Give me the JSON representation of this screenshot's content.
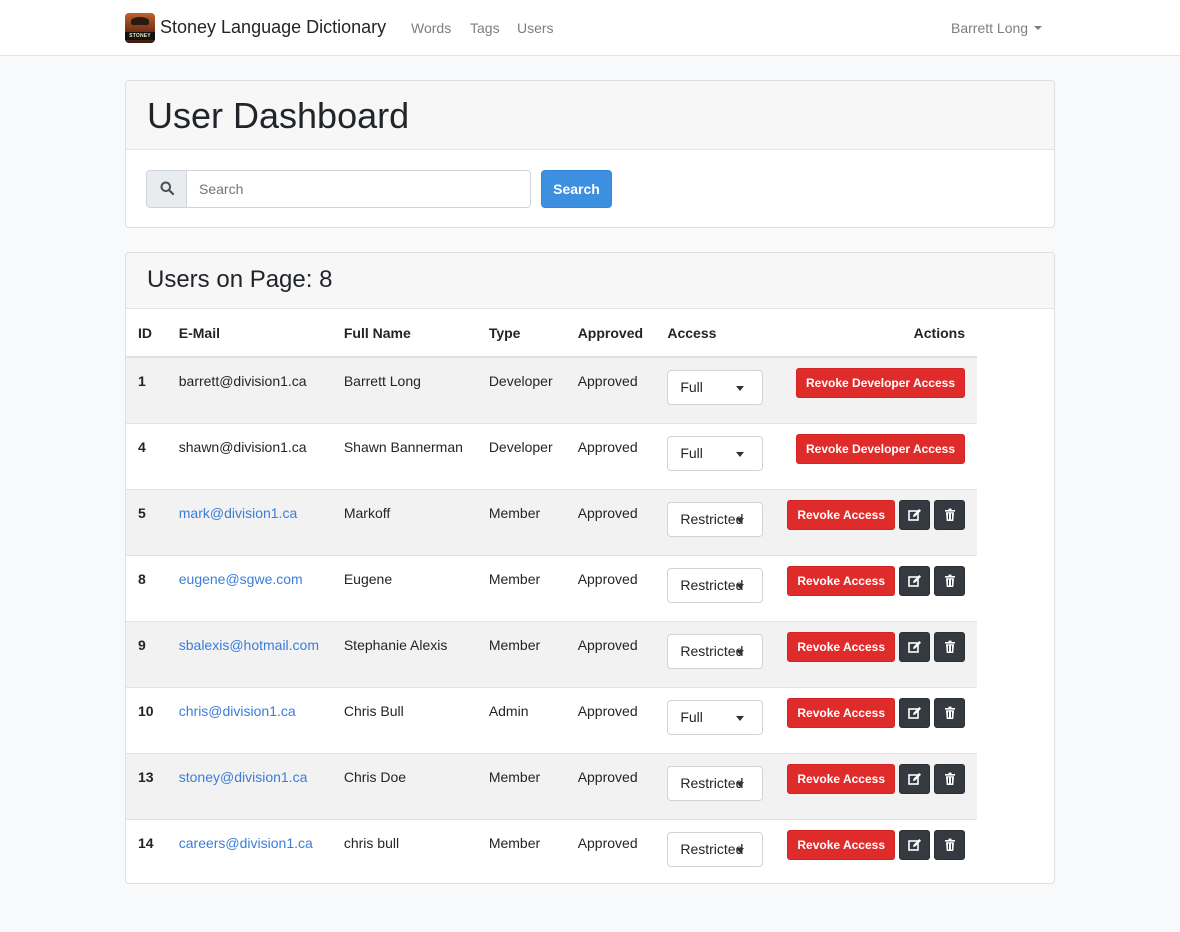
{
  "navbar": {
    "logo_text": "STONEY",
    "brand": "Stoney Language Dictionary",
    "links": [
      "Words",
      "Tags",
      "Users"
    ],
    "user": "Barrett Long"
  },
  "dashboard": {
    "title": "User Dashboard",
    "search_placeholder": "Search",
    "search_button": "Search"
  },
  "users_section": {
    "title": "Users on Page: 8"
  },
  "table": {
    "headers": [
      "ID",
      "E-Mail",
      "Full Name",
      "Type",
      "Approved",
      "Access",
      "Actions"
    ],
    "rows": [
      {
        "id": "1",
        "email": "barrett@division1.ca",
        "name": "Barrett Long",
        "type": "Developer",
        "approved": "Approved",
        "access": "Full",
        "action": "Revoke Developer Access",
        "linked": false,
        "icons": false
      },
      {
        "id": "4",
        "email": "shawn@division1.ca",
        "name": "Shawn Bannerman",
        "type": "Developer",
        "approved": "Approved",
        "access": "Full",
        "action": "Revoke Developer Access",
        "linked": false,
        "icons": false
      },
      {
        "id": "5",
        "email": "mark@division1.ca",
        "name": "Markoff",
        "type": "Member",
        "approved": "Approved",
        "access": "Restricted",
        "action": "Revoke Access",
        "linked": true,
        "icons": true
      },
      {
        "id": "8",
        "email": "eugene@sgwe.com",
        "name": "Eugene",
        "type": "Member",
        "approved": "Approved",
        "access": "Restricted",
        "action": "Revoke Access",
        "linked": true,
        "icons": true
      },
      {
        "id": "9",
        "email": "sbalexis@hotmail.com",
        "name": "Stephanie Alexis",
        "type": "Member",
        "approved": "Approved",
        "access": "Restricted",
        "action": "Revoke Access",
        "linked": true,
        "icons": true
      },
      {
        "id": "10",
        "email": "chris@division1.ca",
        "name": "Chris Bull",
        "type": "Admin",
        "approved": "Approved",
        "access": "Full",
        "action": "Revoke Access",
        "linked": true,
        "icons": true
      },
      {
        "id": "13",
        "email": "stoney@division1.ca",
        "name": "Chris Doe",
        "type": "Member",
        "approved": "Approved",
        "access": "Restricted",
        "action": "Revoke Access",
        "linked": true,
        "icons": true
      },
      {
        "id": "14",
        "email": "careers@division1.ca",
        "name": "chris bull",
        "type": "Member",
        "approved": "Approved",
        "access": "Restricted",
        "action": "Revoke Access",
        "linked": true,
        "icons": true
      }
    ]
  },
  "icons": {
    "search": "search-icon",
    "edit": "edit-icon",
    "delete": "trash-icon"
  },
  "colors": {
    "primary": "#3d8fe0",
    "danger": "#e02b2b",
    "dark": "#343a40",
    "link": "#3b7dd8"
  }
}
